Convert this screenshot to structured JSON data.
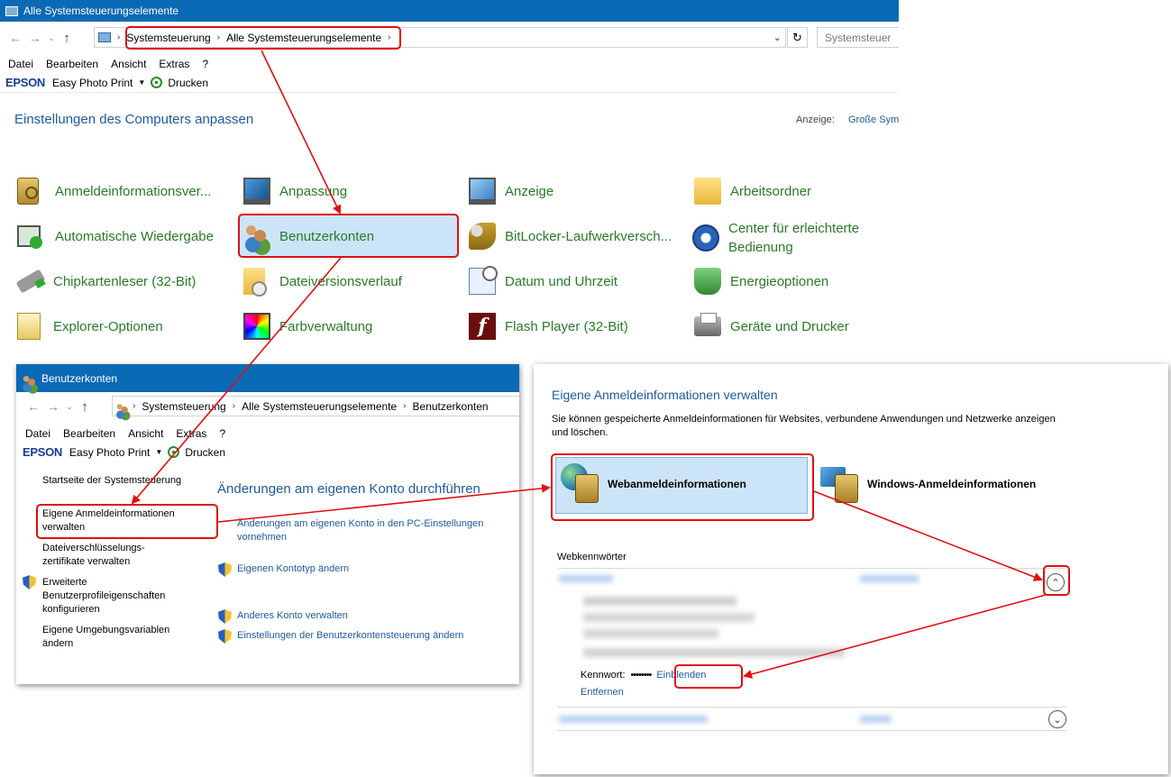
{
  "main_window": {
    "title": "Alle Systemsteuerungselemente",
    "breadcrumb": [
      "Systemsteuerung",
      "Alle Systemsteuerungselemente"
    ],
    "search_placeholder": "Systemsteuer",
    "menu": [
      "Datei",
      "Bearbeiten",
      "Ansicht",
      "Extras",
      "?"
    ],
    "toolbar": {
      "brand": "EPSON",
      "app": "Easy Photo Print",
      "print": "Drucken"
    },
    "heading": "Einstellungen des Computers anpassen",
    "view_label": "Anzeige:",
    "view_value": "Große Sym",
    "items": [
      {
        "label": "Anmeldeinformationsver...",
        "icon": "credential-manager-icon"
      },
      {
        "label": "Anpassung",
        "icon": "personalization-icon"
      },
      {
        "label": "Anzeige",
        "icon": "display-icon"
      },
      {
        "label": "Arbeitsordner",
        "icon": "work-folders-icon"
      },
      {
        "label": "Automatische Wiedergabe",
        "icon": "autoplay-icon"
      },
      {
        "label": "Benutzerkonten",
        "icon": "user-accounts-icon"
      },
      {
        "label": "BitLocker-Laufwerkversch...",
        "icon": "bitlocker-icon"
      },
      {
        "label": "Center für erleichterte Bedienung",
        "icon": "ease-of-access-icon"
      },
      {
        "label": "Chipkartenleser (32-Bit)",
        "icon": "smart-card-reader-icon"
      },
      {
        "label": "Dateiversionsverlauf",
        "icon": "file-history-icon"
      },
      {
        "label": "Datum und Uhrzeit",
        "icon": "date-time-icon"
      },
      {
        "label": "Energieoptionen",
        "icon": "power-options-icon"
      },
      {
        "label": "Explorer-Optionen",
        "icon": "explorer-options-icon"
      },
      {
        "label": "Farbverwaltung",
        "icon": "color-management-icon"
      },
      {
        "label": "Flash Player (32-Bit)",
        "icon": "flash-player-icon"
      },
      {
        "label": "Geräte und Drucker",
        "icon": "devices-printers-icon"
      }
    ]
  },
  "sub_window": {
    "title": "Benutzerkonten",
    "breadcrumb": [
      "Systemsteuerung",
      "Alle Systemsteuerungselemente",
      "Benutzerkonten"
    ],
    "menu": [
      "Datei",
      "Bearbeiten",
      "Ansicht",
      "Extras",
      "?"
    ],
    "toolbar": {
      "brand": "EPSON",
      "app": "Easy Photo Print",
      "print": "Drucken"
    },
    "sidebar": {
      "home": "Startseite der Systemsteuerung",
      "credentials": "Eigene Anmeldeinformationen verwalten",
      "certificate": "Dateiverschlüsselungs- zertifikate verwalten",
      "advanced": "Erweiterte Benutzerprofileigenschaften konfigurieren",
      "env": "Eigene Umgebungsvariablen ändern"
    },
    "heading": "Änderungen am eigenen Konto durchführen",
    "links": {
      "pc_settings": "Änderungen am eigenen Konto in den PC-Einstellungen vornehmen",
      "account_type": "Eigenen Kontotyp ändern",
      "other_account": "Anderes Konto verwalten",
      "uac": "Einstellungen der Benutzerkontensteuerung ändern"
    }
  },
  "cred_panel": {
    "heading": "Eigene Anmeldeinformationen verwalten",
    "description": "Sie können gespeicherte Anmeldeinformationen für Websites, verbundene Anwendungen und Netzwerke anzeigen und löschen.",
    "web_tile": "Webanmeldeinformationen",
    "windows_tile": "Windows-Anmeldeinformationen",
    "section": "Webkennwörter",
    "password_label": "Kennwort:",
    "password_mask": "••••••••",
    "show_link": "Einblenden",
    "remove_link": "Entfernen"
  },
  "colors": {
    "title_bar": "#0b6ab5",
    "item_text": "#2a7a2a",
    "link": "#1e5aa0",
    "highlight": "#e01010",
    "selected_tile": "#cce4f7"
  }
}
